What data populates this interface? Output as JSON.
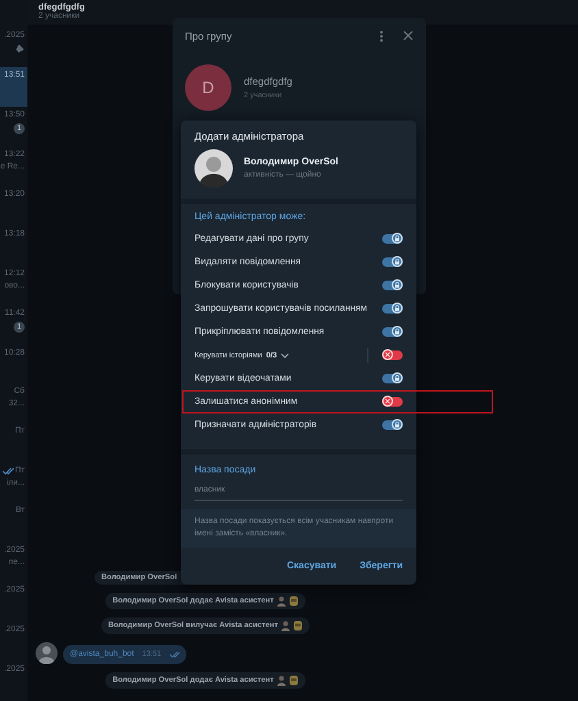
{
  "sidebar": {
    "chats": [
      {
        "time": ".2025",
        "pinned": true,
        "selected": false
      },
      {
        "time": "13:51",
        "selected": true
      },
      {
        "time": "13:50",
        "badge": "1",
        "selected": false
      },
      {
        "time": "13:22",
        "snippet": "e Re...",
        "selected": false
      },
      {
        "time": "13:20",
        "selected": false
      },
      {
        "time": "13:18",
        "selected": false
      },
      {
        "time": "12:12",
        "snippet": "ово...",
        "selected": false
      },
      {
        "time": "11:42",
        "badge": "1",
        "selected": false
      },
      {
        "time": "10:28",
        "selected": false
      },
      {
        "time": "Сб",
        "snippet": "32...",
        "selected": false
      },
      {
        "time": "Пт",
        "selected": false
      },
      {
        "time": "Пт",
        "read": true,
        "snippet": "іли...",
        "selected": false
      },
      {
        "time": "Вт",
        "selected": false
      },
      {
        "time": ".2025",
        "snippet": "пе...",
        "selected": false
      },
      {
        "time": ".2025",
        "selected": false
      },
      {
        "time": ".2025",
        "selected": false
      },
      {
        "time": ".2025",
        "selected": false
      }
    ]
  },
  "chat_header": {
    "title": "dfegdfgdfg",
    "subtitle": "2 учасники"
  },
  "messages": [
    {
      "kind": "service",
      "text": "Володимир OverSol",
      "emoji": false
    },
    {
      "kind": "service",
      "text": "Володимир OverSol додає Avista асистент",
      "emoji": true
    },
    {
      "kind": "service",
      "text": "Володимир OverSol вилучає Avista асистент",
      "emoji": true
    },
    {
      "kind": "message",
      "text": "@avista_buh_bot",
      "time": "13:51",
      "read": true
    },
    {
      "kind": "service",
      "text": "Володимир OverSol додає Avista асистент",
      "emoji": true
    }
  ],
  "about_dialog": {
    "title": "Про групу",
    "avatar_letter": "D",
    "group_name": "dfegdfgdfg",
    "members": "2 учасники"
  },
  "admin_dialog": {
    "title": "Додати адміністратора",
    "user": {
      "name": "Володимир OverSol",
      "status": "активність — щойно"
    },
    "section_title": "Цей адміністратор може:",
    "permissions": [
      {
        "kind": "plain",
        "label": "Редагувати дані про групу",
        "on": true,
        "highlighted": false
      },
      {
        "kind": "plain",
        "label": "Видаляти повідомлення",
        "on": true,
        "highlighted": false
      },
      {
        "kind": "plain",
        "label": "Блокувати користувачів",
        "on": true,
        "highlighted": false
      },
      {
        "kind": "plain",
        "label": "Запрошувати користувачів посиланням",
        "on": true,
        "highlighted": false
      },
      {
        "kind": "plain",
        "label": "Прикріплювати повідомлення",
        "on": true,
        "highlighted": false
      },
      {
        "kind": "expandable",
        "label": "Керувати історіями",
        "count": "0/3",
        "on": false,
        "highlighted": false
      },
      {
        "kind": "plain",
        "label": "Керувати відеочатами",
        "on": true,
        "highlighted": false
      },
      {
        "kind": "plain",
        "label": "Залишатися анонімним",
        "on": false,
        "highlighted": true
      },
      {
        "kind": "plain",
        "label": "Призначати адміністраторів",
        "on": true,
        "highlighted": false
      }
    ],
    "title_field": {
      "label": "Назва посади",
      "value": "власник"
    },
    "hint": "Назва посади показується всім учасникам навпроти імені замість «власник».",
    "buttons": [
      {
        "label": "Скасувати"
      },
      {
        "label": "Зберегти"
      }
    ]
  }
}
